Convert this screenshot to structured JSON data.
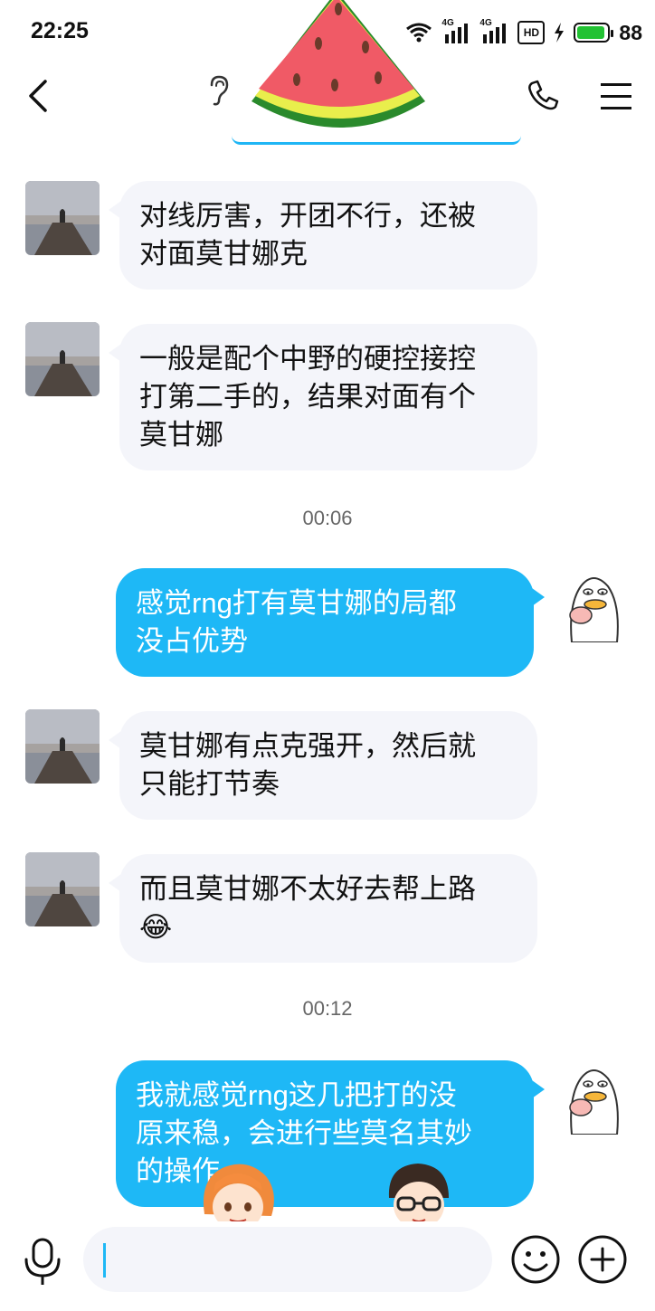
{
  "status_bar": {
    "time": "22:25",
    "signal_1": "4G",
    "signal_2": "4G",
    "hd_label": "HD",
    "battery": "88"
  },
  "nav": {
    "back_icon": "chevron-left-icon",
    "ear_icon": "ear-icon",
    "call_icon": "phone-icon",
    "menu_icon": "menu-icon"
  },
  "messages": [
    {
      "side": "in",
      "text_lines": [
        "对线厉害，开团不行，还被",
        "对面莫甘娜克"
      ]
    },
    {
      "side": "in",
      "text_lines": [
        "一般是配个中野的硬控接控",
        "打第二手的，结果对面有个",
        "莫甘娜"
      ]
    },
    {
      "side": "time",
      "text": "00:06"
    },
    {
      "side": "out",
      "text_lines": [
        "感觉rng打有莫甘娜的局都",
        "没占优势"
      ]
    },
    {
      "side": "in",
      "text_lines": [
        "莫甘娜有点克强开，然后就",
        "只能打节奏"
      ]
    },
    {
      "side": "in",
      "text_lines": [
        "而且莫甘娜不太好去帮上路",
        "😂"
      ]
    },
    {
      "side": "time",
      "text": "00:12"
    },
    {
      "side": "out",
      "text_lines": [
        "我就感觉rng这几把打的没",
        "原来稳，会进行些莫名其妙",
        "的操作"
      ]
    }
  ],
  "input": {
    "value": "",
    "placeholder": ""
  },
  "colors": {
    "outgoing_bubble": "#1eb8f6",
    "incoming_bubble": "#f4f5fa",
    "battery_fill": "#22c233"
  }
}
